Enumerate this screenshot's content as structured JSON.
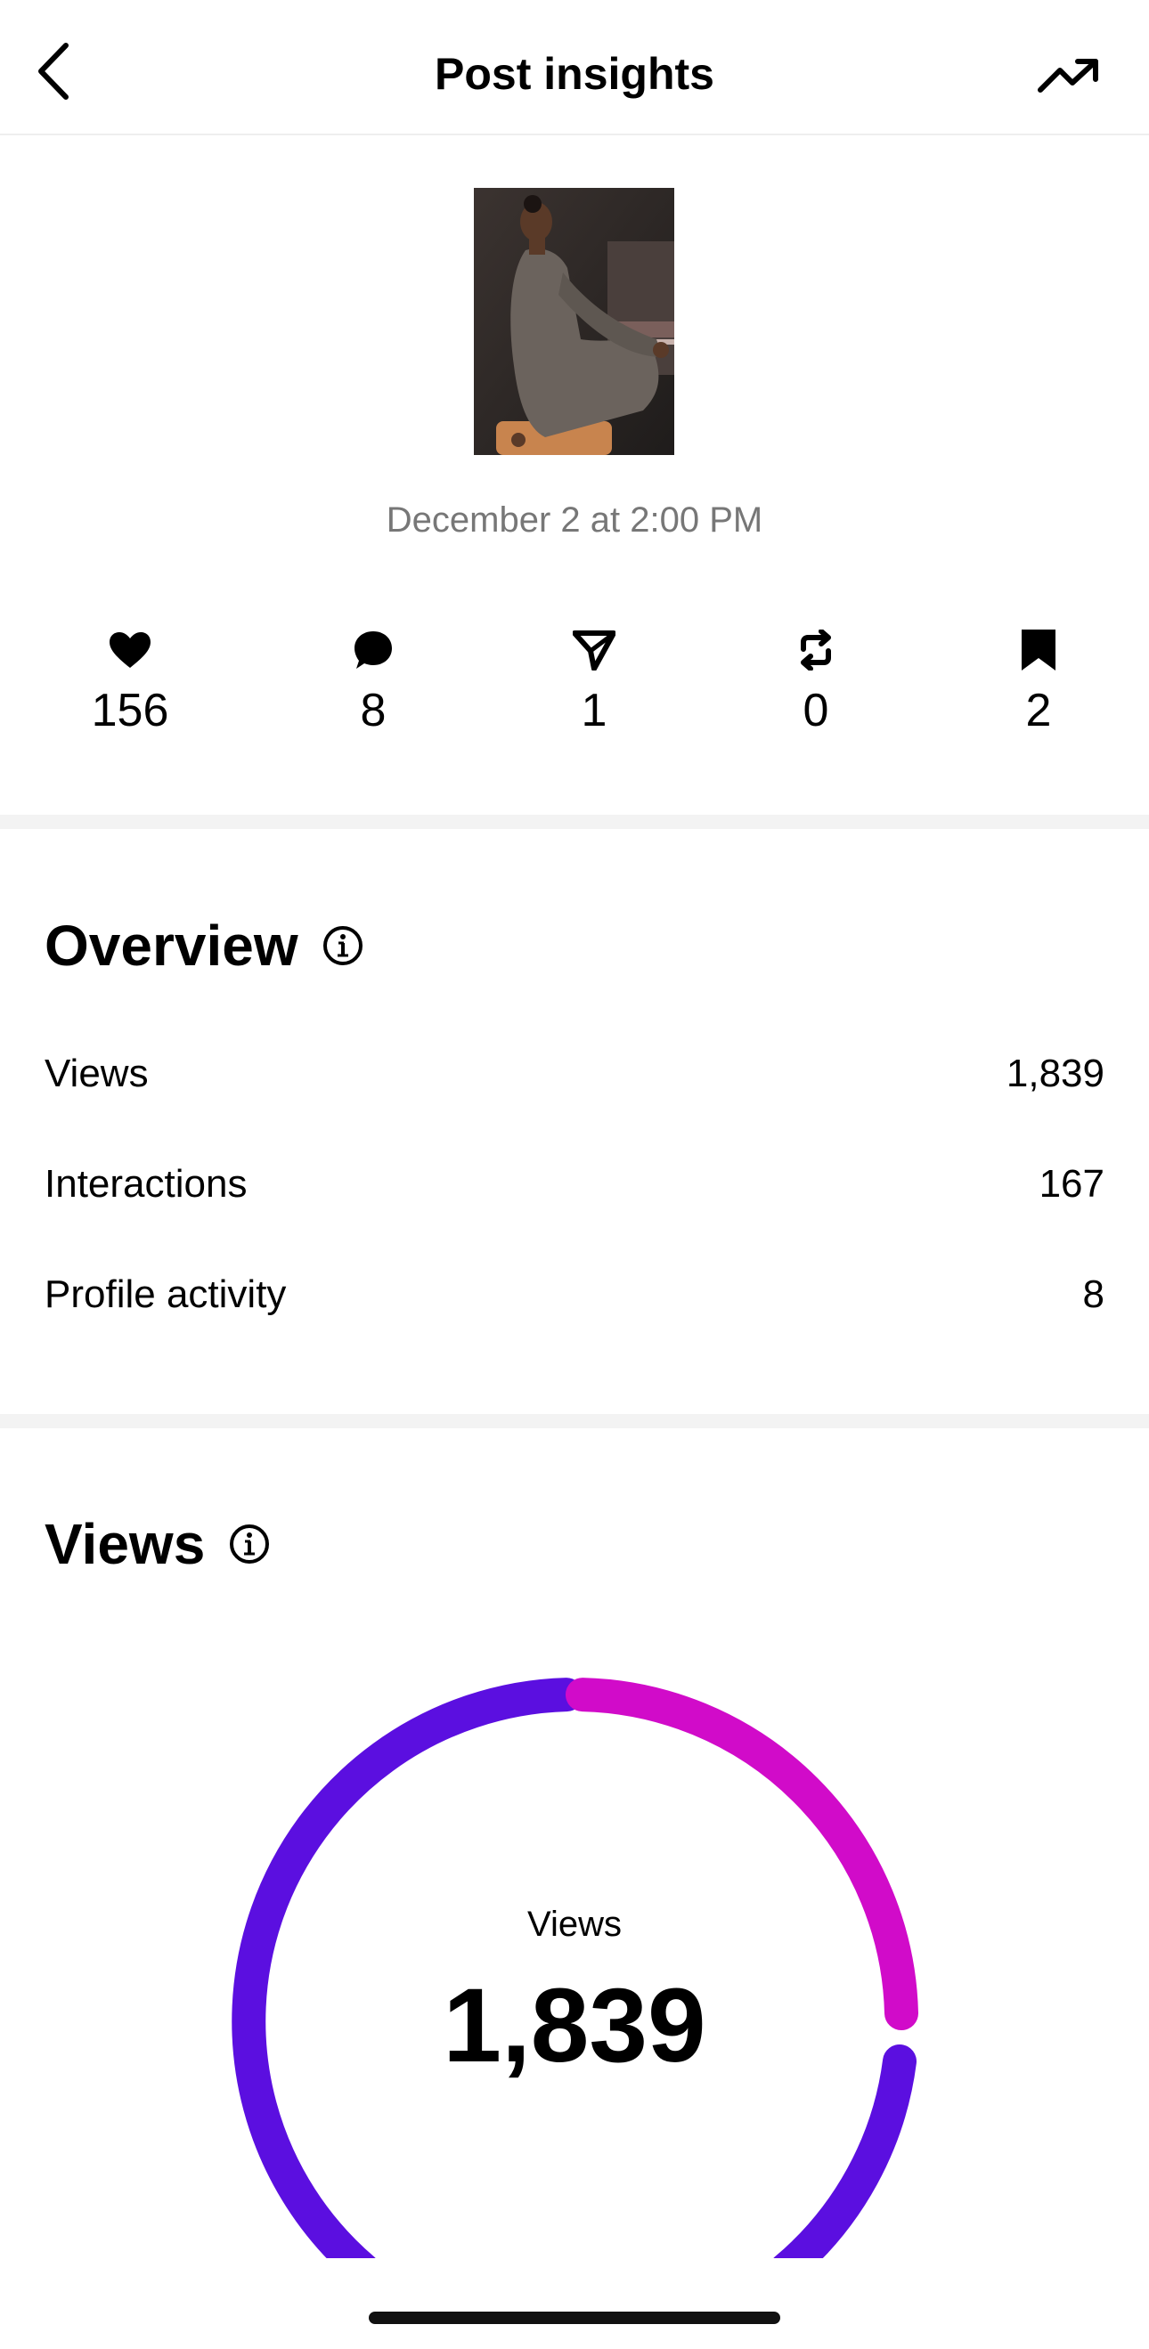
{
  "header": {
    "title": "Post insights",
    "back_icon": "chevron-left-icon",
    "trend_icon": "trending-up-icon"
  },
  "post": {
    "date": "December 2 at 2:00 PM"
  },
  "stats": [
    {
      "icon": "heart-icon",
      "value": "156"
    },
    {
      "icon": "comment-icon",
      "value": "8"
    },
    {
      "icon": "share-icon",
      "value": "1"
    },
    {
      "icon": "repost-icon",
      "value": "0"
    },
    {
      "icon": "bookmark-icon",
      "value": "2"
    }
  ],
  "overview": {
    "title": "Overview",
    "rows": [
      {
        "label": "Views",
        "value": "1,839"
      },
      {
        "label": "Interactions",
        "value": "167"
      },
      {
        "label": "Profile activity",
        "value": "8"
      }
    ]
  },
  "views": {
    "title": "Views",
    "gauge_label": "Views",
    "gauge_value": "1,839",
    "colors": {
      "primary": "#5b0fe0",
      "secondary": "#d10bc9"
    }
  }
}
